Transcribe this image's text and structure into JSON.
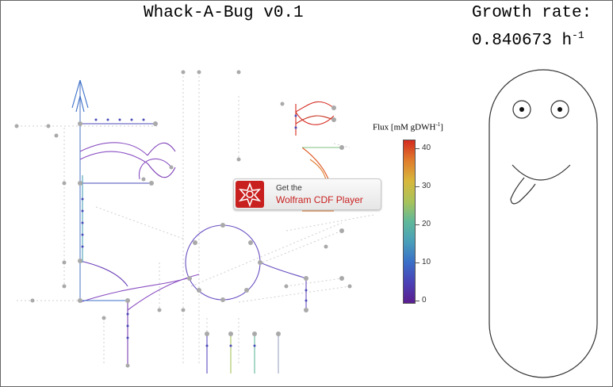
{
  "game": {
    "title": "Whack-A-Bug v0.1",
    "growth_label": "Growth rate:",
    "growth_value": "0.840673",
    "growth_unit_base": "h",
    "growth_unit_exp": "-1"
  },
  "legend": {
    "title_main": "Flux [mM gDWH",
    "title_exp": "-1",
    "title_end": "]",
    "ticks": [
      "40",
      "30",
      "20",
      "10",
      "0"
    ]
  },
  "cdf_banner": {
    "get_text": "Get the",
    "player_name": "Wolfram CDF Player"
  },
  "icons": {
    "cdf_logo": "wolfram-spikey-icon",
    "bug": "bug-character"
  },
  "colors": {
    "flux_low": "#5b1e8f",
    "flux_high": "#d42a1f",
    "banner_red": "#c8201f"
  }
}
